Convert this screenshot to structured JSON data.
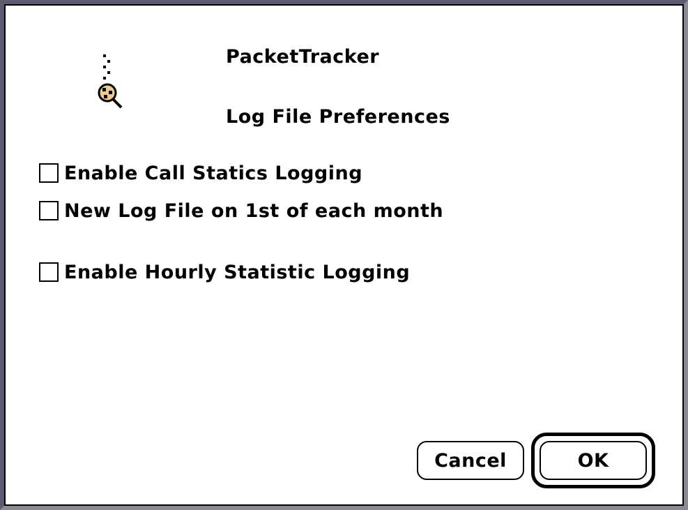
{
  "dialog": {
    "app_name": "PacketTracker",
    "heading": "Log File Preferences",
    "app_icon": "packet-magnifier-icon"
  },
  "options": [
    {
      "label": "Enable Call Statics Logging",
      "checked": false
    },
    {
      "label": "New Log File on 1st of each month",
      "checked": false
    },
    {
      "label": "Enable Hourly Statistic Logging",
      "checked": false
    }
  ],
  "buttons": {
    "cancel_label": "Cancel",
    "ok_label": "OK",
    "default": "OK"
  },
  "colors": {
    "window_border": "#5c5c6e",
    "icon_fill": "#f0c890"
  }
}
